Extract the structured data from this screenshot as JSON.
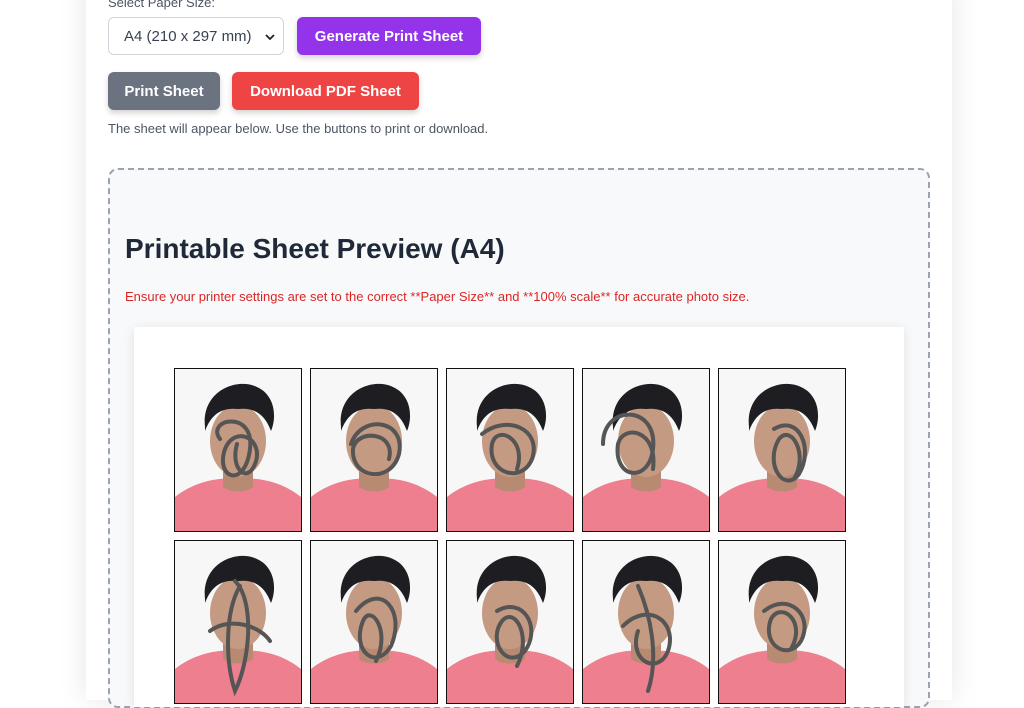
{
  "controls": {
    "paper_size_label": "Select Paper Size:",
    "paper_size_value": "A4 (210 x 297 mm)",
    "generate_label": "Generate Print Sheet",
    "print_label": "Print Sheet",
    "download_label": "Download PDF Sheet",
    "hint": "The sheet will appear below. Use the buttons to print or download."
  },
  "preview": {
    "title": "Printable Sheet Preview (A4)",
    "warning": "Ensure your printer settings are set to the correct **Paper Size** and **100% scale** for accurate photo size."
  },
  "colors": {
    "generate": "#9333ea",
    "print": "#6b7280",
    "download": "#ef4444",
    "warning": "#dc2626"
  },
  "photos": {
    "count": 10,
    "columns": 5,
    "description": "passport-size photo with scribbled-over face"
  }
}
